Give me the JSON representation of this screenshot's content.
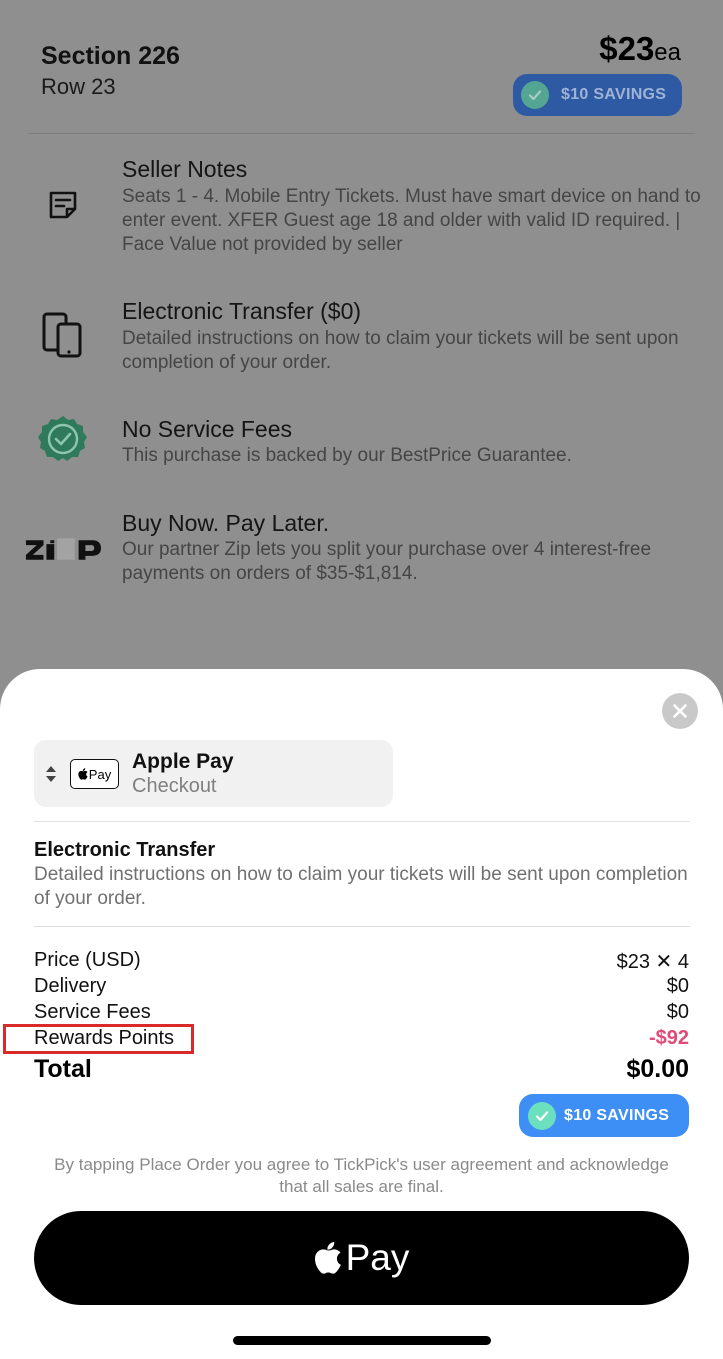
{
  "listing": {
    "section": "Section 226",
    "row": "Row 23",
    "price": "$23",
    "price_unit": "ea",
    "savings_badge": "$10 SAVINGS"
  },
  "features": [
    {
      "icon": "notes-icon",
      "title": "Seller Notes",
      "description": "Seats 1 - 4. Mobile Entry Tickets. Must have smart device on hand to enter event. XFER Guest age 18 and older with valid ID required. | Face Value not provided by seller"
    },
    {
      "icon": "devices-icon",
      "title": "Electronic Transfer ($0)",
      "description": "Detailed instructions on how to claim your tickets will be sent upon completion of your order."
    },
    {
      "icon": "badge-check-icon",
      "title": "No Service Fees",
      "description": "This purchase is backed by our BestPrice Guarantee."
    },
    {
      "icon": "zip-logo",
      "logo_text": "Zip",
      "title": "Buy Now. Pay Later.",
      "description": "Our partner Zip lets you split your purchase over 4 interest-free payments on orders of $35-$1,814."
    }
  ],
  "sheet": {
    "payment_method": {
      "logo_text": "Pay",
      "name": "Apple Pay",
      "sub": "Checkout"
    },
    "delivery": {
      "title": "Electronic Transfer",
      "description": "Detailed instructions on how to claim your tickets will be sent upon completion of your order."
    },
    "lines": [
      {
        "label": "Price (USD)",
        "value": "$23 ✕ 4"
      },
      {
        "label": "Delivery",
        "value": "$0"
      },
      {
        "label": "Service Fees",
        "value": "$0"
      },
      {
        "label": "Rewards Points",
        "value": "-$92"
      }
    ],
    "total_label": "Total",
    "total_value": "$0.00",
    "savings_badge": "$10 SAVINGS",
    "terms": "By tapping Place Order you agree to TickPick's user agreement and acknowledge that all sales are final.",
    "pay_button_label": "Pay"
  },
  "colors": {
    "negative": "#e24a77",
    "savings_blue": "#3d8ef5",
    "highlight": "#d92a2a"
  }
}
